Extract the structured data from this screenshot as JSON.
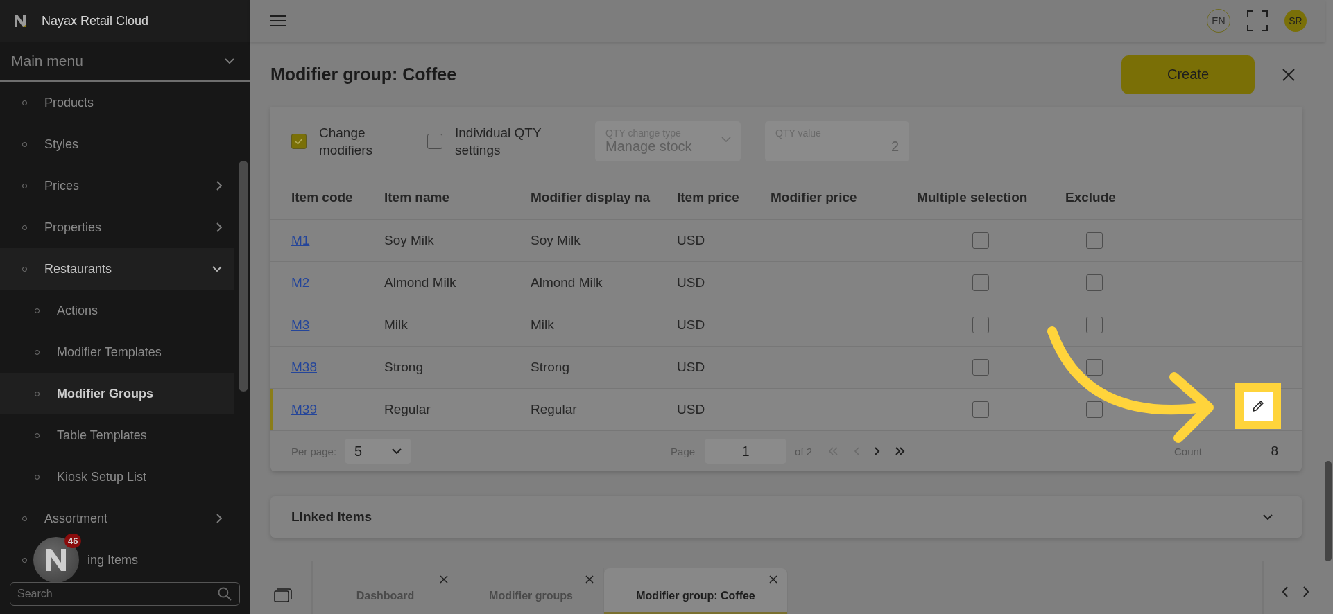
{
  "app": {
    "title": "Nayax Retail Cloud"
  },
  "sidebar": {
    "menu_title": "Main menu",
    "items": [
      {
        "label": "Products",
        "selected": false
      },
      {
        "label": "Styles",
        "selected": false
      },
      {
        "label": "Prices",
        "selected": false,
        "expanded": false
      },
      {
        "label": "Properties",
        "selected": false,
        "expanded": false
      },
      {
        "label": "Restaurants",
        "selected": false,
        "expanded": true,
        "children": [
          {
            "label": "Actions",
            "selected": false
          },
          {
            "label": "Modifier Templates",
            "selected": false
          },
          {
            "label": "Modifier Groups",
            "selected": true
          },
          {
            "label": "Table Templates",
            "selected": false
          },
          {
            "label": "Kiosk Setup List",
            "selected": false
          }
        ]
      },
      {
        "label": "Assortment",
        "selected": false,
        "expanded": false
      },
      {
        "label": "ing Items",
        "selected": false
      }
    ],
    "notification_count": "46",
    "search": {
      "placeholder": "Search"
    }
  },
  "header": {
    "language": "EN",
    "avatar": "SR"
  },
  "page": {
    "title": "Modifier group: Coffee",
    "create_button": "Create"
  },
  "options": {
    "change_modifiers": {
      "label": "Change modifiers",
      "checked": true
    },
    "individual_qty": {
      "label": "Individual QTY settings",
      "checked": false
    },
    "qty_change_type": {
      "label": "QTY change type",
      "value": "Manage stock"
    },
    "qty_value": {
      "label": "QTY value",
      "value": "2"
    }
  },
  "table": {
    "columns": [
      "Item code",
      "Item name",
      "Modifier display na",
      "Item price",
      "Modifier price",
      "Multiple selection",
      "Exclude"
    ],
    "rows": [
      {
        "item_code": "M1",
        "item_name": "Soy Milk",
        "display_name": "Soy Milk",
        "item_price": "USD",
        "multiple_selection": false,
        "exclude": false,
        "selected": false
      },
      {
        "item_code": "M2",
        "item_name": "Almond Milk",
        "display_name": "Almond Milk",
        "item_price": "USD",
        "multiple_selection": false,
        "exclude": false,
        "selected": false
      },
      {
        "item_code": "M3",
        "item_name": "Milk",
        "display_name": "Milk",
        "item_price": "USD",
        "multiple_selection": false,
        "exclude": false,
        "selected": false
      },
      {
        "item_code": "M38",
        "item_name": "Strong",
        "display_name": "Strong",
        "item_price": "USD",
        "multiple_selection": false,
        "exclude": false,
        "selected": false
      },
      {
        "item_code": "M39",
        "item_name": "Regular",
        "display_name": "Regular",
        "item_price": "USD",
        "multiple_selection": false,
        "exclude": false,
        "selected": true
      }
    ]
  },
  "pagination": {
    "per_page_label": "Per page:",
    "per_page": "5",
    "page_label": "Page",
    "page": "1",
    "of_pages": "of 2",
    "count_label": "Count",
    "count": "8"
  },
  "linked_items": {
    "title": "Linked items",
    "expanded": false
  },
  "tabs": [
    {
      "label": "Dashboard",
      "selected": false
    },
    {
      "label": "Modifier groups",
      "selected": false
    },
    {
      "label": "Modifier group: Coffee",
      "selected": true
    }
  ]
}
